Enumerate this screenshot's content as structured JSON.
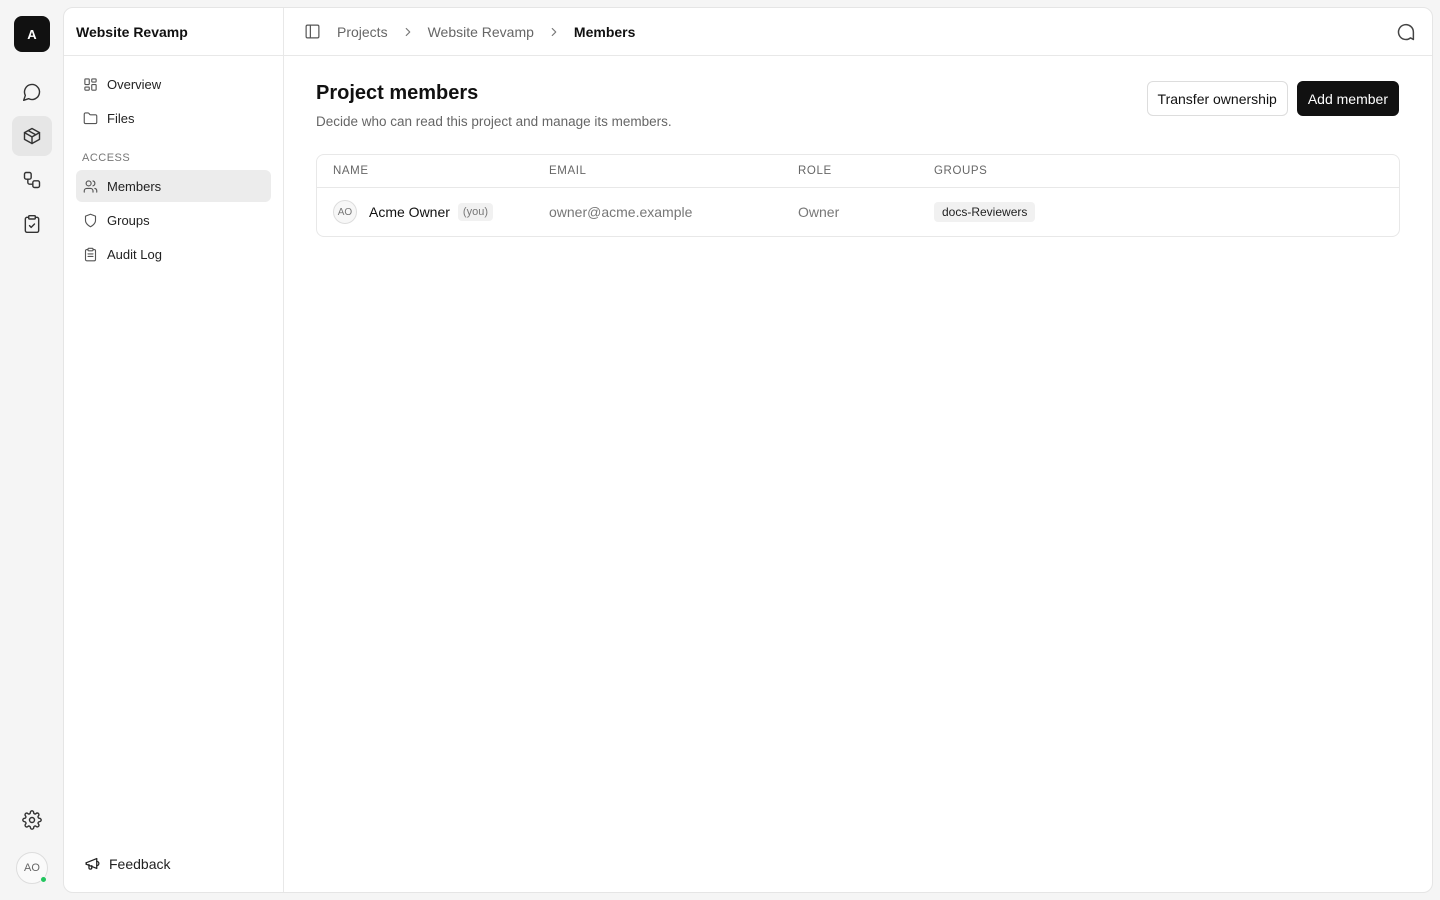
{
  "rail": {
    "logo_letter": "A",
    "items": [
      {
        "icon": "chat-icon",
        "active": false
      },
      {
        "icon": "box-icon",
        "active": true
      },
      {
        "icon": "workflow-icon",
        "active": false
      },
      {
        "icon": "clipboard-check-icon",
        "active": false
      }
    ],
    "settings_icon": "gear-icon",
    "user_initials": "AO",
    "user_status_color": "#22c55e"
  },
  "sidebar": {
    "title": "Website Revamp",
    "items": [
      {
        "label": "Overview",
        "icon": "grid-icon"
      },
      {
        "label": "Files",
        "icon": "folder-icon"
      }
    ],
    "section_label": "ACCESS",
    "access_items": [
      {
        "label": "Members",
        "icon": "users-icon",
        "active": true
      },
      {
        "label": "Groups",
        "icon": "shield-icon",
        "active": false
      },
      {
        "label": "Audit Log",
        "icon": "clipboard-icon",
        "active": false
      }
    ],
    "feedback_label": "Feedback"
  },
  "breadcrumb": {
    "items": [
      "Projects",
      "Website Revamp",
      "Members"
    ]
  },
  "page": {
    "title": "Project members",
    "subtitle": "Decide who can read this project and manage its members.",
    "transfer_label": "Transfer ownership",
    "add_label": "Add member"
  },
  "table": {
    "columns": [
      "NAME",
      "EMAIL",
      "ROLE",
      "GROUPS"
    ],
    "rows": [
      {
        "initials": "AO",
        "name": "Acme Owner",
        "badge": "(you)",
        "email": "owner@acme.example",
        "role": "Owner",
        "group": "docs-Reviewers"
      }
    ]
  },
  "colors": {
    "accent": "#111111",
    "active_nav_bg": "#ececec"
  }
}
